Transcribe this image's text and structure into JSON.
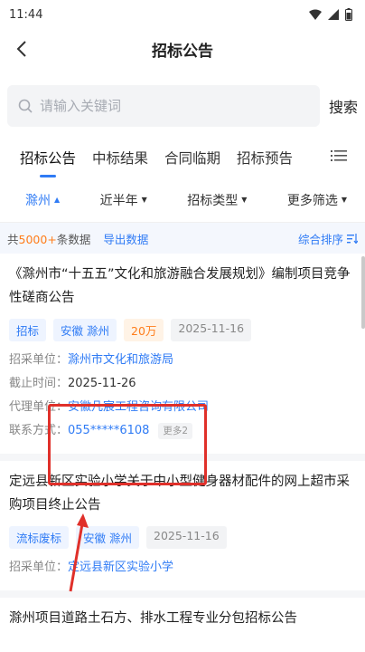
{
  "status_bar": {
    "time": "11:44"
  },
  "nav": {
    "title": "招标公告"
  },
  "search": {
    "placeholder": "请输入关键词",
    "button": "搜索"
  },
  "tabs": [
    {
      "label": "招标公告",
      "active": true
    },
    {
      "label": "中标结果"
    },
    {
      "label": "合同临期"
    },
    {
      "label": "招标预告"
    }
  ],
  "filters": [
    {
      "label": "滁州",
      "active": true
    },
    {
      "label": "近半年"
    },
    {
      "label": "招标类型"
    },
    {
      "label": "更多筛选"
    }
  ],
  "summary": {
    "prefix": "共",
    "count": "5000+",
    "suffix": "条数据",
    "export": "导出数据",
    "sort": "综合排序"
  },
  "cards": [
    {
      "title": "《滁州市“十五五”文化和旅游融合发展规划》编制项目竞争性磋商公告",
      "tags": [
        "招标",
        "安徽 滁州",
        "20万",
        "2025-11-16"
      ],
      "rows": [
        {
          "label": "招采单位：",
          "value": "滁州市文化和旅游局"
        },
        {
          "label": "截止时间：",
          "value": "2025-11-26"
        },
        {
          "label": "代理单位：",
          "value": "安徽凡宸工程咨询有限公司"
        },
        {
          "label": "联系方式：",
          "value": "055*****6108",
          "more": "更多2"
        }
      ]
    },
    {
      "title": "定远县新区实验小学关于中小型健身器材配件的网上超市采购项目终止公告",
      "tags": [
        "流标废标",
        "安徽 滁州",
        "2025-11-16"
      ],
      "rows": [
        {
          "label": "招采单位：",
          "value": "定远县新区实验小学"
        }
      ]
    },
    {
      "title": "滁州项目道路土石方、排水工程专业分包招标公告"
    }
  ]
}
